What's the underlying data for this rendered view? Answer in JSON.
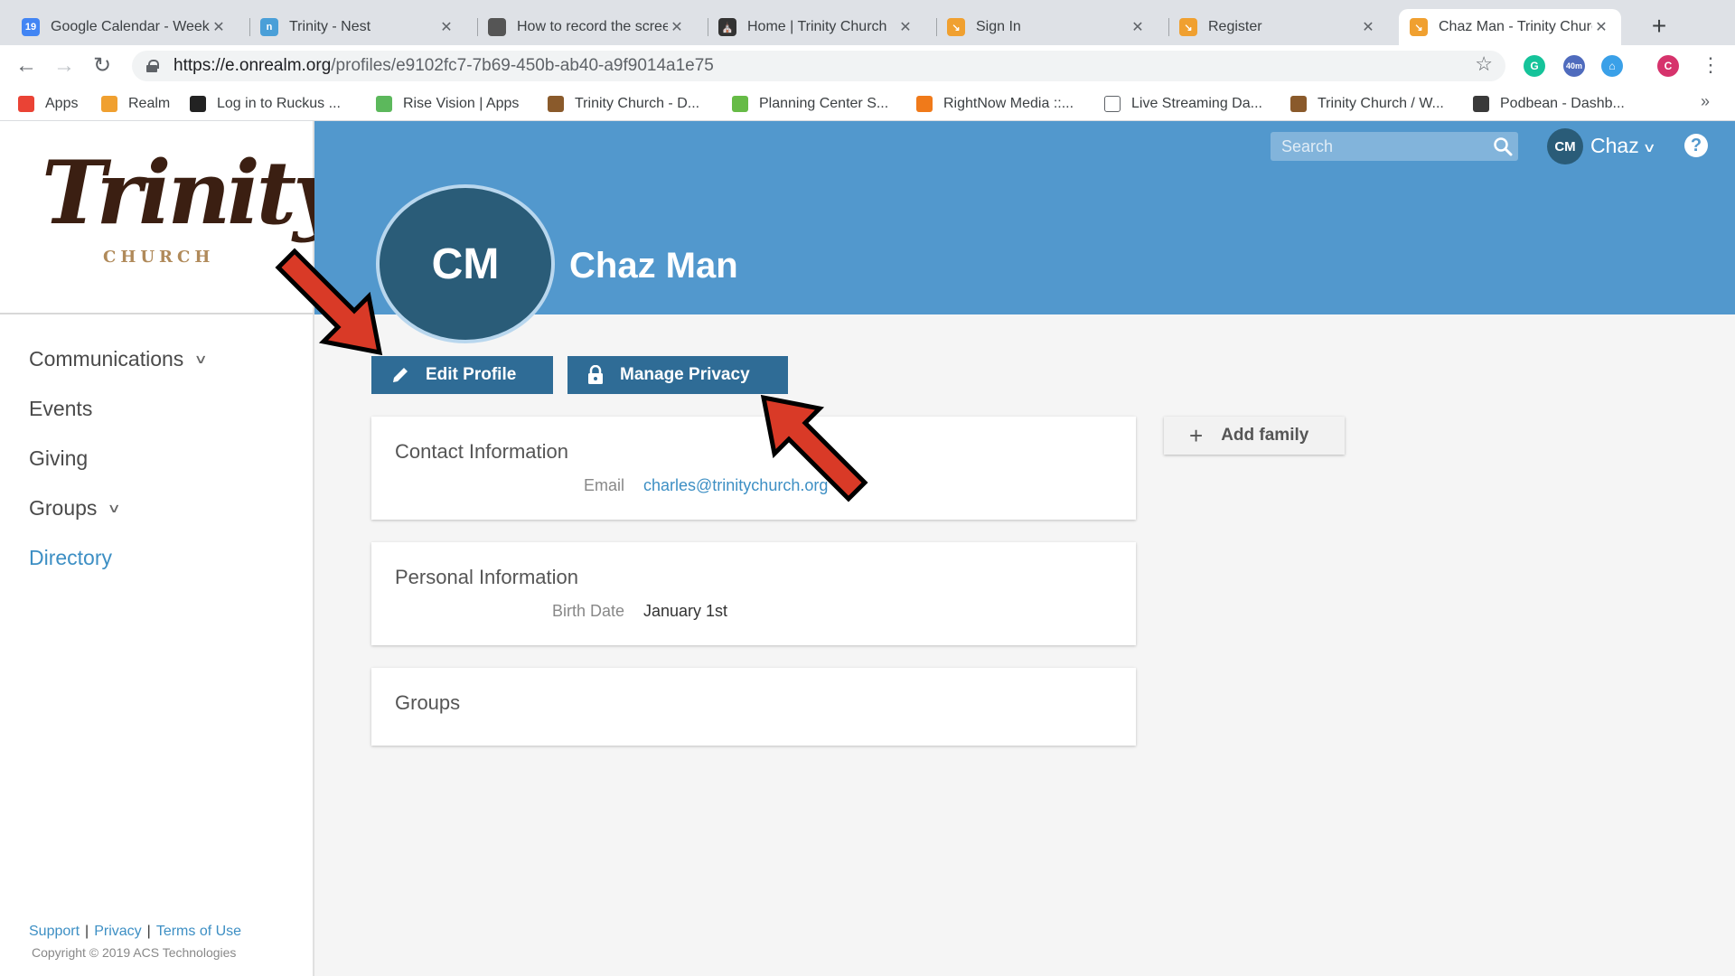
{
  "browser": {
    "tabs": [
      {
        "title": "Google Calendar - Week",
        "favicon": "calendar-icon",
        "color": "#4285f4",
        "glyph": "19"
      },
      {
        "title": "Trinity - Nest",
        "favicon": "nest-icon",
        "color": "#4a9fd8",
        "glyph": "n"
      },
      {
        "title": "How to record the screen",
        "favicon": "apple-icon",
        "color": "#555555",
        "glyph": ""
      },
      {
        "title": "Home | Trinity Church",
        "favicon": "church-icon",
        "color": "#333333",
        "glyph": "⛪"
      },
      {
        "title": "Sign In",
        "favicon": "realm-icon",
        "color": "#f0a030",
        "glyph": "↘"
      },
      {
        "title": "Register",
        "favicon": "realm-icon",
        "color": "#f0a030",
        "glyph": "↘"
      },
      {
        "title": "Chaz Man - Trinity Church",
        "favicon": "realm-icon",
        "color": "#f0a030",
        "glyph": "↘",
        "active": true
      }
    ],
    "new_tab": "+",
    "url": {
      "host": "https://e.onrealm.org",
      "path": "/profiles/e9102fc7-7b69-450b-ab40-a9f9014a1e75"
    },
    "extensions": [
      {
        "name": "grammarly-icon",
        "color": "#15c39a",
        "glyph": "G"
      },
      {
        "name": "timer-extension-icon",
        "color": "#4f6bbd",
        "glyph": "40m"
      },
      {
        "name": "home-extension-icon",
        "color": "#3aa0e8",
        "glyph": "⌂"
      },
      {
        "name": "profile-icon",
        "color": "#d6336c",
        "glyph": "C"
      }
    ],
    "bookmarks": [
      {
        "label": "Apps",
        "icon": "apps-grid-icon",
        "color": "#ea4335"
      },
      {
        "label": "Realm",
        "icon": "realm-icon",
        "color": "#f0a030"
      },
      {
        "label": "Log in to Ruckus ...",
        "icon": "ruckus-icon",
        "color": "#222222"
      },
      {
        "label": "Rise Vision | Apps",
        "icon": "rise-vision-icon",
        "color": "#5cb85c"
      },
      {
        "label": "Trinity Church - D...",
        "icon": "cross-icon",
        "color": "#8a5a2b"
      },
      {
        "label": "Planning Center S...",
        "icon": "planning-center-icon",
        "color": "#66bb46"
      },
      {
        "label": "RightNow Media ::...",
        "icon": "rightnow-icon",
        "color": "#f07a1a"
      },
      {
        "label": "Live Streaming Da...",
        "icon": "page-icon",
        "color": "#ffffff"
      },
      {
        "label": "Trinity Church / W...",
        "icon": "cross-icon",
        "color": "#8a5a2b"
      },
      {
        "label": "Podbean - Dashb...",
        "icon": "podbean-icon",
        "color": "#3a3a3a"
      }
    ],
    "bookmarks_more": "»"
  },
  "sidebar": {
    "logo_word": "Trinity",
    "logo_sub": "CHURCH",
    "items": [
      {
        "label": "Communications",
        "chevron": true
      },
      {
        "label": "Events",
        "chevron": false
      },
      {
        "label": "Giving",
        "chevron": false
      },
      {
        "label": "Groups",
        "chevron": true
      },
      {
        "label": "Directory",
        "chevron": false,
        "active": true
      }
    ],
    "footer": {
      "support": "Support",
      "privacy": "Privacy",
      "terms": "Terms of Use",
      "copyright": "Copyright © 2019 ACS Technologies"
    }
  },
  "header": {
    "search_placeholder": "Search",
    "user_initials": "CM",
    "user_name": "Chaz",
    "help": "?"
  },
  "profile": {
    "initials": "CM",
    "name": "Chaz Man",
    "edit_label": "Edit Profile",
    "privacy_label": "Manage Privacy",
    "add_family_label": "Add family",
    "contact": {
      "title": "Contact Information",
      "email_label": "Email",
      "email": "charles@trinitychurch.org"
    },
    "personal": {
      "title": "Personal Information",
      "birth_label": "Birth Date",
      "birth": "January 1st"
    },
    "groups": {
      "title": "Groups"
    }
  },
  "colors": {
    "banner": "#5298cd",
    "button": "#2f6c96",
    "link": "#3d8fc4",
    "arrow": "#d93a27"
  }
}
